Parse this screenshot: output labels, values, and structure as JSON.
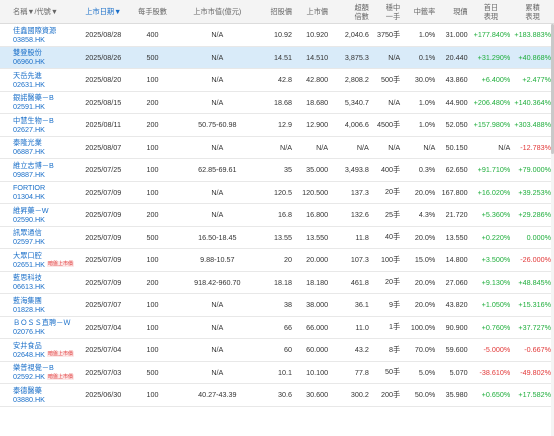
{
  "headers": {
    "name": "名稱▼/代號▼",
    "date": "上市日期▼",
    "lot": "每手股數",
    "cap": "上市市值(億元)",
    "ipo": "招股價",
    "list": "上市價",
    "sub": [
      "超額",
      "倍數"
    ],
    "one": [
      "穩中",
      "一手"
    ],
    "win": "中籤率",
    "close": "現價",
    "d1": [
      "首日",
      "表現"
    ],
    "cum": [
      "累積",
      "表現"
    ]
  },
  "rows": [
    {
      "name": "佳鑫國際資源",
      "code": "03858.HK",
      "date": "2025/08/28",
      "lot": "400",
      "cap": "N/A",
      "ipo": "10.92",
      "list": "10.920",
      "sub": "2,040.6",
      "one": "3750手",
      "win": "1.0%",
      "close": "31.000",
      "d1": "+177.840%",
      "cum": "+183.883%",
      "d1s": "pos",
      "cums": "pos"
    },
    {
      "name": "雙登股份",
      "code": "06960.HK",
      "date": "2025/08/26",
      "lot": "500",
      "cap": "N/A",
      "ipo": "14.51",
      "list": "14.510",
      "sub": "3,875.3",
      "one": "N/A",
      "win": "0.1%",
      "close": "20.440",
      "d1": "+31.290%",
      "cum": "+40.868%",
      "d1s": "pos",
      "cums": "pos",
      "sel": true
    },
    {
      "name": "天岳先進",
      "code": "02631.HK",
      "date": "2025/08/20",
      "lot": "100",
      "cap": "N/A",
      "ipo": "42.8",
      "list": "42.800",
      "sub": "2,808.2",
      "one": "500手",
      "win": "30.0%",
      "close": "43.860",
      "d1": "+6.400%",
      "cum": "+2.477%",
      "d1s": "pos",
      "cums": "pos"
    },
    {
      "name": "銀諾醫藥－B",
      "code": "02591.HK",
      "date": "2025/08/15",
      "lot": "200",
      "cap": "N/A",
      "ipo": "18.68",
      "list": "18.680",
      "sub": "5,340.7",
      "one": "N/A",
      "win": "1.0%",
      "close": "44.900",
      "d1": "+206.480%",
      "cum": "+140.364%",
      "d1s": "pos",
      "cums": "pos"
    },
    {
      "name": "中慧生物－B",
      "code": "02627.HK",
      "date": "2025/08/11",
      "lot": "200",
      "cap": "50.75-60.98",
      "ipo": "12.9",
      "list": "12.900",
      "sub": "4,006.6",
      "one": "4500手",
      "win": "1.0%",
      "close": "52.050",
      "d1": "+157.980%",
      "cum": "+303.488%",
      "d1s": "pos",
      "cums": "pos"
    },
    {
      "name": "泰隆光業",
      "code": "06887.HK",
      "date": "2025/08/07",
      "lot": "100",
      "cap": "N/A",
      "ipo": "N/A",
      "list": "N/A",
      "sub": "N/A",
      "one": "N/A",
      "win": "N/A",
      "close": "50.150",
      "d1": "N/A",
      "cum": "-12.783%",
      "d1s": "plain",
      "cums": "neg"
    },
    {
      "name": "維立志博－B",
      "code": "09887.HK",
      "date": "2025/07/25",
      "lot": "100",
      "cap": "62.85-69.61",
      "ipo": "35",
      "list": "35.000",
      "sub": "3,493.8",
      "one": "400手",
      "win": "0.3%",
      "close": "62.650",
      "d1": "+91.710%",
      "cum": "+79.000%",
      "d1s": "pos",
      "cums": "pos"
    },
    {
      "name": "FORTIOR",
      "code": "01304.HK",
      "date": "2025/07/09",
      "lot": "100",
      "cap": "N/A",
      "ipo": "120.5",
      "list": "120.500",
      "sub": "137.3",
      "one": "20手",
      "win": "20.0%",
      "close": "167.800",
      "d1": "+16.020%",
      "cum": "+39.253%",
      "d1s": "pos",
      "cums": "pos"
    },
    {
      "name": "維昇藥－W",
      "code": "02590.HK",
      "date": "2025/07/09",
      "lot": "200",
      "cap": "N/A",
      "ipo": "16.8",
      "list": "16.800",
      "sub": "132.6",
      "one": "25手",
      "win": "4.3%",
      "close": "21.720",
      "d1": "+5.360%",
      "cum": "+29.286%",
      "d1s": "pos",
      "cums": "pos"
    },
    {
      "name": "訊眾通信",
      "code": "02597.HK",
      "date": "2025/07/09",
      "lot": "500",
      "cap": "16.50-18.45",
      "ipo": "13.55",
      "list": "13.550",
      "sub": "11.8",
      "one": "40手",
      "win": "20.0%",
      "close": "13.550",
      "d1": "+0.220%",
      "cum": "0.000%",
      "d1s": "pos",
      "cums": "pos"
    },
    {
      "name": "大眾口腔",
      "code": "02651.HK",
      "tag": "暗盤上市價",
      "date": "2025/07/09",
      "lot": "100",
      "cap": "9.88-10.57",
      "ipo": "20",
      "list": "20.000",
      "sub": "107.3",
      "one": "100手",
      "win": "15.0%",
      "close": "14.800",
      "d1": "+3.500%",
      "cum": "-26.000%",
      "d1s": "pos",
      "cums": "neg"
    },
    {
      "name": "藍思科技",
      "code": "06613.HK",
      "date": "2025/07/09",
      "lot": "200",
      "cap": "918.42-960.70",
      "ipo": "18.18",
      "list": "18.180",
      "sub": "461.8",
      "one": "20手",
      "win": "20.0%",
      "close": "27.060",
      "d1": "+9.130%",
      "cum": "+48.845%",
      "d1s": "pos",
      "cums": "pos"
    },
    {
      "name": "藍海集團",
      "code": "01828.HK",
      "date": "2025/07/07",
      "lot": "100",
      "cap": "N/A",
      "ipo": "38",
      "list": "38.000",
      "sub": "36.1",
      "one": "9手",
      "win": "20.0%",
      "close": "43.820",
      "d1": "+1.050%",
      "cum": "+15.316%",
      "d1s": "pos",
      "cums": "pos"
    },
    {
      "name": "ＢＯＳＳ直聘－Ｗ",
      "code": "02076.HK",
      "date": "2025/07/04",
      "lot": "100",
      "cap": "N/A",
      "ipo": "66",
      "list": "66.000",
      "sub": "11.0",
      "one": "1手",
      "win": "100.0%",
      "close": "90.900",
      "d1": "+0.760%",
      "cum": "+37.727%",
      "d1s": "pos",
      "cums": "pos"
    },
    {
      "name": "安井食品",
      "code": "02648.HK",
      "tag": "暗盤上市價",
      "date": "2025/07/04",
      "lot": "100",
      "cap": "N/A",
      "ipo": "60",
      "list": "60.000",
      "sub": "43.2",
      "one": "8手",
      "win": "70.0%",
      "close": "59.600",
      "d1": "-5.000%",
      "cum": "-0.667%",
      "d1s": "neg",
      "cums": "neg"
    },
    {
      "name": "樂普視覺－B",
      "code": "02592.HK",
      "tag": "暗盤上市價",
      "date": "2025/07/03",
      "lot": "500",
      "cap": "N/A",
      "ipo": "10.1",
      "list": "10.100",
      "sub": "77.8",
      "one": "50手",
      "win": "5.0%",
      "close": "5.070",
      "d1": "-38.610%",
      "cum": "-49.802%",
      "d1s": "neg",
      "cums": "neg"
    },
    {
      "name": "泰德醫藥",
      "code": "03880.HK",
      "date": "2025/06/30",
      "lot": "100",
      "cap": "40.27-43.39",
      "ipo": "30.6",
      "list": "30.600",
      "sub": "300.2",
      "one": "200手",
      "win": "50.0%",
      "close": "35.980",
      "d1": "+0.650%",
      "cum": "+17.582%",
      "d1s": "pos",
      "cums": "pos"
    }
  ]
}
